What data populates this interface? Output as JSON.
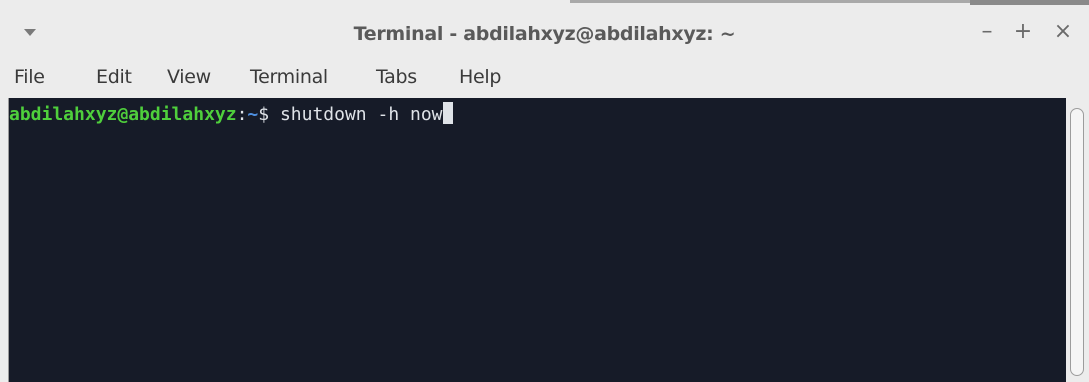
{
  "window": {
    "title": "Terminal - abdilahxyz@abdilahxyz: ~",
    "controls": {
      "minimize": "–",
      "maximize": "+",
      "close": "×"
    },
    "menu_icon": "chevron-down-icon"
  },
  "menubar": {
    "items": [
      "File",
      "Edit",
      "View",
      "Terminal",
      "Tabs",
      "Help"
    ]
  },
  "terminal": {
    "prompt_user": "abdilahxyz@abdilahxyz",
    "prompt_colon": ":",
    "prompt_path": "~",
    "prompt_symbol": "$ ",
    "command": "shutdown -h now",
    "colors": {
      "background": "#161b28",
      "user": "#4fcf3c",
      "path": "#4e8fe0",
      "text": "#dfe3e8"
    }
  }
}
